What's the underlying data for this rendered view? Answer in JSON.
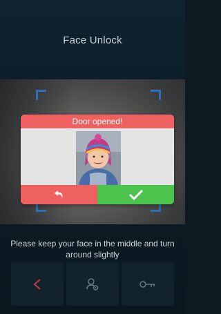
{
  "screen": {
    "title": "Face Unlock",
    "hint_line1": "Please keep your face in the middle and turn",
    "hint_line2": "around slightly"
  },
  "dialog": {
    "title": "Door opened!",
    "back_icon": "undo-arrow-icon",
    "confirm_icon": "checkmark-icon"
  },
  "bottom_bar": {
    "buttons": [
      {
        "icon": "back-chevron-icon",
        "color": "#c23a4a"
      },
      {
        "icon": "user-settings-icon",
        "color": "#6b7a80"
      },
      {
        "icon": "key-icon",
        "color": "#6b7a80"
      }
    ]
  },
  "colors": {
    "dialog_red": "#ef6060",
    "dialog_green": "#4cc34d",
    "frame_blue": "#2f6fb5"
  }
}
